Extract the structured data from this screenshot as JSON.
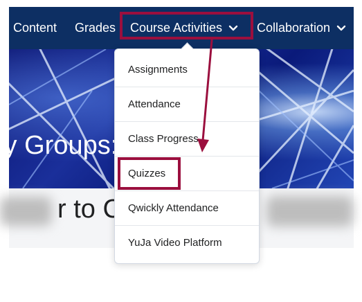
{
  "navbar": {
    "items": [
      {
        "label": "Content"
      },
      {
        "label": "Grades"
      },
      {
        "label": "Course Activities"
      },
      {
        "label": "Collaboration"
      }
    ]
  },
  "banner": {
    "title": "ty Groups:"
  },
  "content": {
    "heading_fragment": "r to C"
  },
  "dropdown": {
    "items": [
      {
        "label": "Assignments"
      },
      {
        "label": "Attendance"
      },
      {
        "label": "Class Progress"
      },
      {
        "label": "Quizzes"
      },
      {
        "label": "Qwickly Attendance"
      },
      {
        "label": "YuJa Video Platform"
      }
    ]
  },
  "colors": {
    "navbar_bg": "#0d2f63",
    "highlight": "#9b0f3e",
    "banner_blue": "#1a2f9a"
  }
}
